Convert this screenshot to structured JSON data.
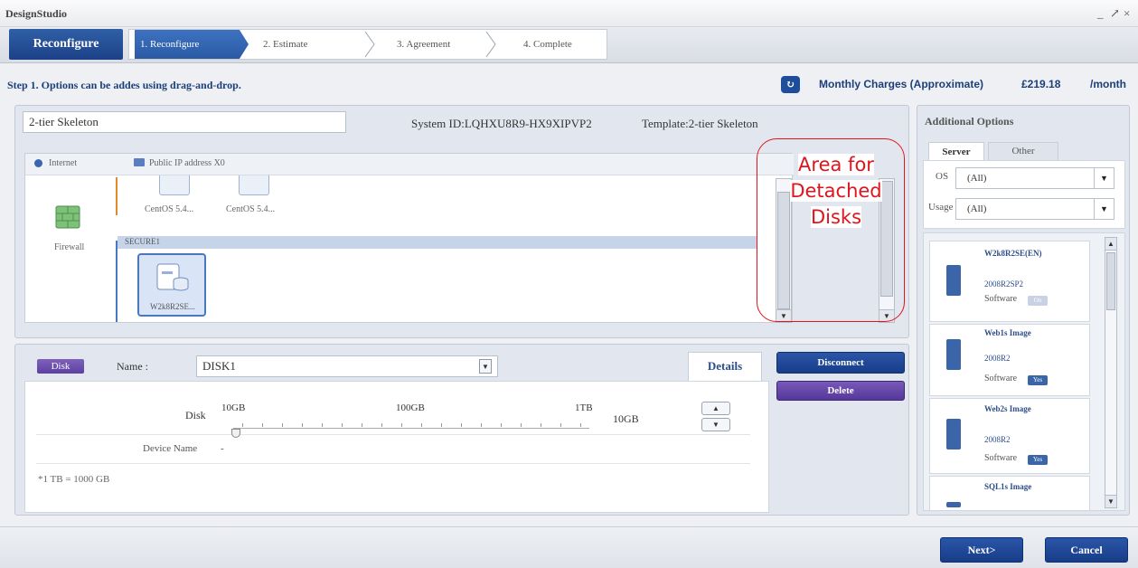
{
  "app": {
    "title": "DesignStudio",
    "minimize": "_",
    "restore": "↗",
    "close": "×"
  },
  "wizard": {
    "section_label": "Reconfigure",
    "steps": [
      {
        "label": "1. Reconfigure",
        "active": true
      },
      {
        "label": "2. Estimate",
        "active": false
      },
      {
        "label": "3. Agreement",
        "active": false
      },
      {
        "label": "4. Complete",
        "active": false
      }
    ]
  },
  "step_instruction": "Step 1. Options can be addes using drag-and-drop.",
  "charges": {
    "label": "Monthly Charges (Approximate)",
    "amount": "£219.18",
    "unit": "/month"
  },
  "system": {
    "name": "2-tier Skeleton",
    "id_text": "System ID:LQHXU8R9-HX9XIPVP2",
    "template_text": "Template:2-tier Skeleton"
  },
  "network": {
    "internet": "Internet",
    "public_ip": "Public IP address X0",
    "firewall": "Firewall",
    "vm1": "CentOS 5.4...",
    "vm2": "CentOS 5.4...",
    "segment": "SECURE1",
    "server": "W2k8R2SE..."
  },
  "annotation": {
    "line1": "Area for",
    "line2": "Detached",
    "line3": "Disks"
  },
  "disk": {
    "tag": "Disk",
    "name_label": "Name :",
    "name_value": "DISK1",
    "details_label": "Details",
    "disk_label": "Disk",
    "scale": [
      "10GB",
      "100GB",
      "1TB"
    ],
    "size_value": "10GB",
    "device_label": "Device Name",
    "device_value": "-",
    "note": "*1 TB = 1000 GB"
  },
  "actions": {
    "disconnect": "Disconnect",
    "delete": "Delete",
    "next": "Next>",
    "cancel": "Cancel"
  },
  "options": {
    "title": "Additional Options",
    "tabs": [
      "Server",
      "Other"
    ],
    "os_label": "OS",
    "os_value": "(All)",
    "usage_label": "Usage",
    "usage_value": "(All)",
    "items": [
      {
        "name": "W2k8R2SE(EN)",
        "version": "2008R2SP2",
        "type": "Software",
        "badge": "On"
      },
      {
        "name": "Web1s Image",
        "version": "2008R2",
        "type": "Software",
        "badge": "Yes"
      },
      {
        "name": "Web2s Image",
        "version": "2008R2",
        "type": "Software",
        "badge": "Yes"
      },
      {
        "name": "SQL1s Image",
        "version": "",
        "type": "",
        "badge": ""
      }
    ]
  },
  "colors": {
    "accent": "#1c4188",
    "purple": "#55389a",
    "annotation": "#e0141c"
  },
  "icons": {
    "calc": "refresh-calculator-icon",
    "firewall": "firewall-icon",
    "vm": "vm-icon",
    "server": "server-icon"
  }
}
